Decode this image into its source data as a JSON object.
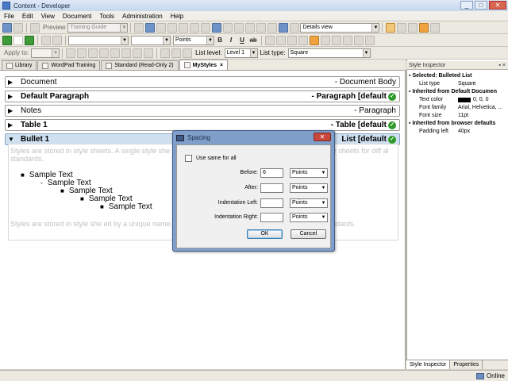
{
  "window": {
    "title": "Content - Developer"
  },
  "menu": [
    "File",
    "Edit",
    "View",
    "Document",
    "Tools",
    "Administration",
    "Help"
  ],
  "toolbar1": {
    "preview_label": "Preview",
    "stylesheet_select": "Training Guide",
    "view_select": "Details view"
  },
  "toolbar2": {
    "style_select": "",
    "unit_select": "Points",
    "bold": "B",
    "italic": "I",
    "underline": "U",
    "strike": "ab"
  },
  "toolbar3": {
    "apply_to_label": "Apply to:",
    "list_level_label": "List level:",
    "list_level_value": "Level 1",
    "list_type_label": "List type:",
    "list_type_value": "Square"
  },
  "tabs": [
    {
      "label": "Library"
    },
    {
      "label": "WordPad Training"
    },
    {
      "label": "Standard (Read-Only 2)"
    },
    {
      "label": "MyStyles",
      "close": "×"
    }
  ],
  "styles": [
    {
      "name": "Document",
      "type": "- Document Body",
      "bold": false,
      "arrow": "▶",
      "default": false
    },
    {
      "name": "Default Paragraph",
      "type": "- Paragraph [default",
      "bold": true,
      "arrow": "▶",
      "default": true
    },
    {
      "name": "Notes",
      "type": "- Paragraph",
      "bold": false,
      "arrow": "▶",
      "default": false
    },
    {
      "name": "Table 1",
      "type": "- Table [default",
      "bold": true,
      "arrow": "▶",
      "default": true
    },
    {
      "name": "Bullet 1",
      "type": "List [default",
      "bold": true,
      "arrow": "▼",
      "default": true,
      "expanded": true
    }
  ],
  "preview": {
    "text_top": "Styles are stored in style sheets. A single style she                                                      ed by a unique name. You can create separate style sheets for diff                                                al standards.",
    "text_bottom": "Styles are stored in style she                                                                                              ed by a unique name. You can create separate style sheets for diff                                                al standards.",
    "bullets": [
      {
        "text": "Sample Text",
        "glyph": "■"
      },
      {
        "text": "Sample Text",
        "glyph": "◦"
      },
      {
        "text": "Sample Text",
        "glyph": "■"
      },
      {
        "text": "Sample Text",
        "glyph": "■"
      },
      {
        "text": "Sample Text",
        "glyph": "■"
      }
    ]
  },
  "dialog": {
    "title": "Spacing",
    "close": "✕",
    "use_same_label": "Use same for all",
    "fields": [
      {
        "label": "Before:",
        "value": "6",
        "unit": "Points"
      },
      {
        "label": "After:",
        "value": "",
        "unit": "Points"
      },
      {
        "label": "Indentation Left:",
        "value": "",
        "unit": "Points"
      },
      {
        "label": "Indentation Right:",
        "value": "",
        "unit": "Points"
      }
    ],
    "ok_label": "OK",
    "cancel_label": "Cancel"
  },
  "inspector": {
    "title": "Style Inspector",
    "pins": "▪ ×",
    "sections": [
      {
        "heading": "Selected: Bulleted List",
        "props": [
          {
            "key": "List type",
            "value": "Square"
          }
        ]
      },
      {
        "heading": "Inherited from Default Documen",
        "props": [
          {
            "key": "Text color",
            "value": "0, 0, 0",
            "swatch": "#000000"
          },
          {
            "key": "Font family",
            "value": "Arial, Helvetica, ..."
          },
          {
            "key": "Font size",
            "value": "11pt"
          }
        ]
      },
      {
        "heading": "Inherited from browser defaults",
        "props": [
          {
            "key": "Padding left",
            "value": "40px"
          }
        ]
      }
    ],
    "tabs": [
      "Style Inspector",
      "Properties"
    ]
  },
  "status": {
    "text": "Online"
  },
  "colors": {
    "accent": "#cfe0f1",
    "check": "#2f9a2a"
  }
}
